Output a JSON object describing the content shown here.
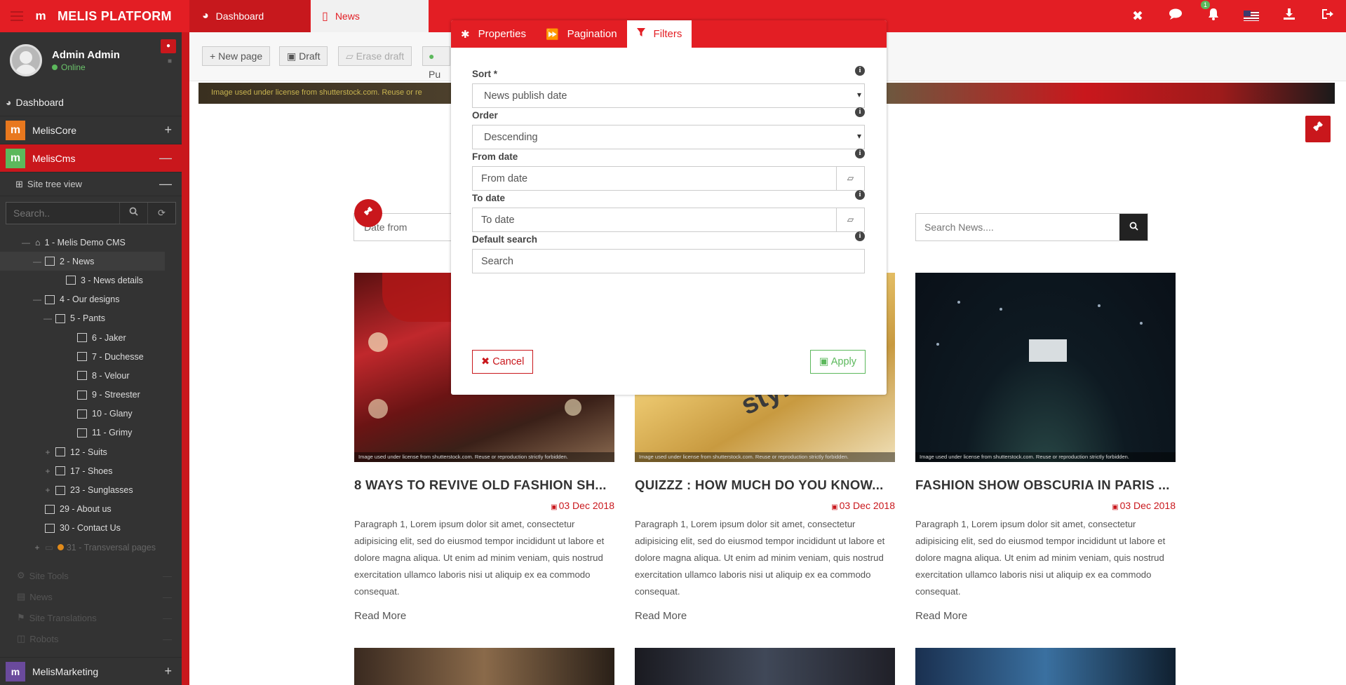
{
  "app": {
    "brand": "MELIS PLATFORM",
    "logo_glyph": "m"
  },
  "tabs": [
    {
      "label": "Dashboard"
    },
    {
      "label": "News"
    }
  ],
  "top_icons": {
    "close": "✖",
    "chat": "💬",
    "notifications_count": "1",
    "bell": "🔔",
    "download": "⬇",
    "logout": "⇥"
  },
  "profile": {
    "name": "Admin Admin",
    "status": "Online"
  },
  "sidebar": {
    "dashboard": "Dashboard",
    "modules": [
      {
        "label": "MelisCore",
        "color": "#e8781e",
        "toggle": "+"
      },
      {
        "label": "MelisCms",
        "color": "#5cb85c",
        "toggle": "—"
      }
    ],
    "site_tree_label": "Site tree view",
    "search_placeholder": "Search..",
    "tree": [
      {
        "label": "1 - Melis Demo CMS",
        "depth": 0,
        "toggle": "—",
        "home": true
      },
      {
        "label": "2 - News",
        "depth": 1,
        "toggle": "—",
        "selected": true
      },
      {
        "label": "3 - News details",
        "depth": 2,
        "toggle": ""
      },
      {
        "label": "4 - Our designs",
        "depth": 1,
        "toggle": "—"
      },
      {
        "label": "5 - Pants",
        "depth": 2,
        "toggle": "—"
      },
      {
        "label": "6 - Jaker",
        "depth": 3,
        "toggle": ""
      },
      {
        "label": "7 - Duchesse",
        "depth": 3,
        "toggle": ""
      },
      {
        "label": "8 - Velour",
        "depth": 3,
        "toggle": ""
      },
      {
        "label": "9 - Streester",
        "depth": 3,
        "toggle": ""
      },
      {
        "label": "10 - Glany",
        "depth": 3,
        "toggle": ""
      },
      {
        "label": "11 - Grimy",
        "depth": 3,
        "toggle": ""
      },
      {
        "label": "12 - Suits",
        "depth": 2,
        "toggle": "+"
      },
      {
        "label": "17 - Shoes",
        "depth": 2,
        "toggle": "+"
      },
      {
        "label": "23 - Sunglasses",
        "depth": 2,
        "toggle": "+"
      },
      {
        "label": "29 - About us",
        "depth": 1,
        "toggle": ""
      },
      {
        "label": "30 - Contact Us",
        "depth": 1,
        "toggle": ""
      },
      {
        "label": "31 - Transversal pages",
        "depth": 0,
        "toggle": "+",
        "dim": true
      }
    ],
    "lower_items": [
      "Site Tools",
      "News",
      "Site Translations",
      "Robots"
    ],
    "marketing": {
      "label": "MelisMarketing",
      "color": "#6a4a9c",
      "toggle": "+"
    }
  },
  "toolbar": {
    "new_page": "New page",
    "draft": "Draft",
    "erase_draft": "Erase draft",
    "publish_partial": "Pu"
  },
  "banner_text": "Image used under license from shutterstock.com. Reuse or re",
  "page_filters": {
    "date_from_placeholder": "Date from",
    "search_placeholder": "Search News...."
  },
  "cards": [
    {
      "title": "8 WAYS TO REVIVE OLD FASHION SH...",
      "date": "03 Dec 2018",
      "para": "Paragraph 1, Lorem ipsum dolor sit amet, consectetur adipisicing elit, sed do eiusmod tempor incididunt ut labore et dolore magna aliqua. Ut enim ad minim veniam, quis nostrud exercitation ullamco laboris nisi ut aliquip ex ea commodo consequat.",
      "more": "Read More",
      "license": "Image used under license from shutterstock.com. Reuse or reproduction strictly forbidden."
    },
    {
      "title": "QUIZZZ : HOW MUCH DO YOU KNOW...",
      "date": "03 Dec 2018",
      "para": "Paragraph 1, Lorem ipsum dolor sit amet, consectetur adipisicing elit, sed do eiusmod tempor incididunt ut labore et dolore magna aliqua. Ut enim ad minim veniam, quis nostrud exercitation ullamco laboris nisi ut aliquip ex ea commodo consequat.",
      "more": "Read More",
      "license": "Image used under license from shutterstock.com. Reuse or reproduction strictly forbidden.",
      "img_text": "style"
    },
    {
      "title": "FASHION SHOW OBSCURIA IN PARIS ...",
      "date": "03 Dec 2018",
      "para": "Paragraph 1, Lorem ipsum dolor sit amet, consectetur adipisicing elit, sed do eiusmod tempor incididunt ut labore et dolore magna aliqua. Ut enim ad minim veniam, quis nostrud exercitation ullamco laboris nisi ut aliquip ex ea commodo consequat.",
      "more": "Read More",
      "license": "Image used under license from shutterstock.com. Reuse or reproduction strictly forbidden."
    }
  ],
  "modal": {
    "tabs": [
      {
        "label": "Properties",
        "icon": "gear-icon"
      },
      {
        "label": "Pagination",
        "icon": "forward-icon"
      },
      {
        "label": "Filters",
        "icon": "filter-icon",
        "active": true
      }
    ],
    "sort": {
      "label": "Sort *",
      "value": "News publish date"
    },
    "order": {
      "label": "Order",
      "value": "Descending"
    },
    "from_date": {
      "label": "From date",
      "placeholder": "From date"
    },
    "to_date": {
      "label": "To date",
      "placeholder": "To date"
    },
    "default_search": {
      "label": "Default search",
      "placeholder": "Search"
    },
    "cancel": "Cancel",
    "apply": "Apply"
  },
  "colors": {
    "brand_red": "#e31e24",
    "sidebar": "#333333",
    "success": "#5cb85c"
  }
}
